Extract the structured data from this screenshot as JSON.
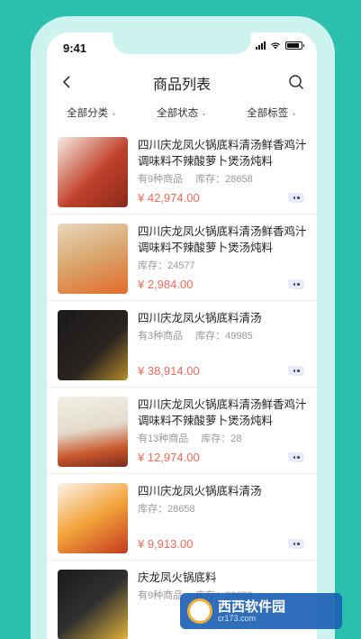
{
  "status_bar": {
    "time": "9:41"
  },
  "nav": {
    "title": "商品列表",
    "back_icon": "chevron-left-icon",
    "search_icon": "search-icon"
  },
  "filters": [
    {
      "label": "全部分类"
    },
    {
      "label": "全部状态"
    },
    {
      "label": "全部标签"
    }
  ],
  "products": [
    {
      "name": "四川庆龙凤火锅底料清汤鲜香鸡汁调味料不辣酸萝卜煲汤炖料",
      "variants": "有9种商品",
      "stock": "库存：28658",
      "price": "¥ 42,974.00"
    },
    {
      "name": "四川庆龙凤火锅底料清汤鲜香鸡汁调味料不辣酸萝卜煲汤炖料",
      "variants": "",
      "stock": "库存：24577",
      "price": "¥ 2,984.00"
    },
    {
      "name": "四川庆龙凤火锅底料清汤",
      "variants": "有3种商品",
      "stock": "库存：49985",
      "price": "¥ 38,914.00"
    },
    {
      "name": "四川庆龙凤火锅底料清汤鲜香鸡汁调味料不辣酸萝卜煲汤炖料",
      "variants": "有13种商品",
      "stock": "库存：28",
      "price": "¥ 12,974.00"
    },
    {
      "name": "四川庆龙凤火锅底料清汤",
      "variants": "",
      "stock": "库存：28658",
      "price": "¥ 9,913.00"
    },
    {
      "name": "庆龙凤火锅底料",
      "variants": "有9种商品",
      "stock": "库存：28658",
      "price": ""
    }
  ],
  "watermark": {
    "brand": "西西软件园",
    "site": "cr173.com"
  },
  "colors": {
    "accent": "#2bbfae",
    "price": "#f26a5a"
  }
}
